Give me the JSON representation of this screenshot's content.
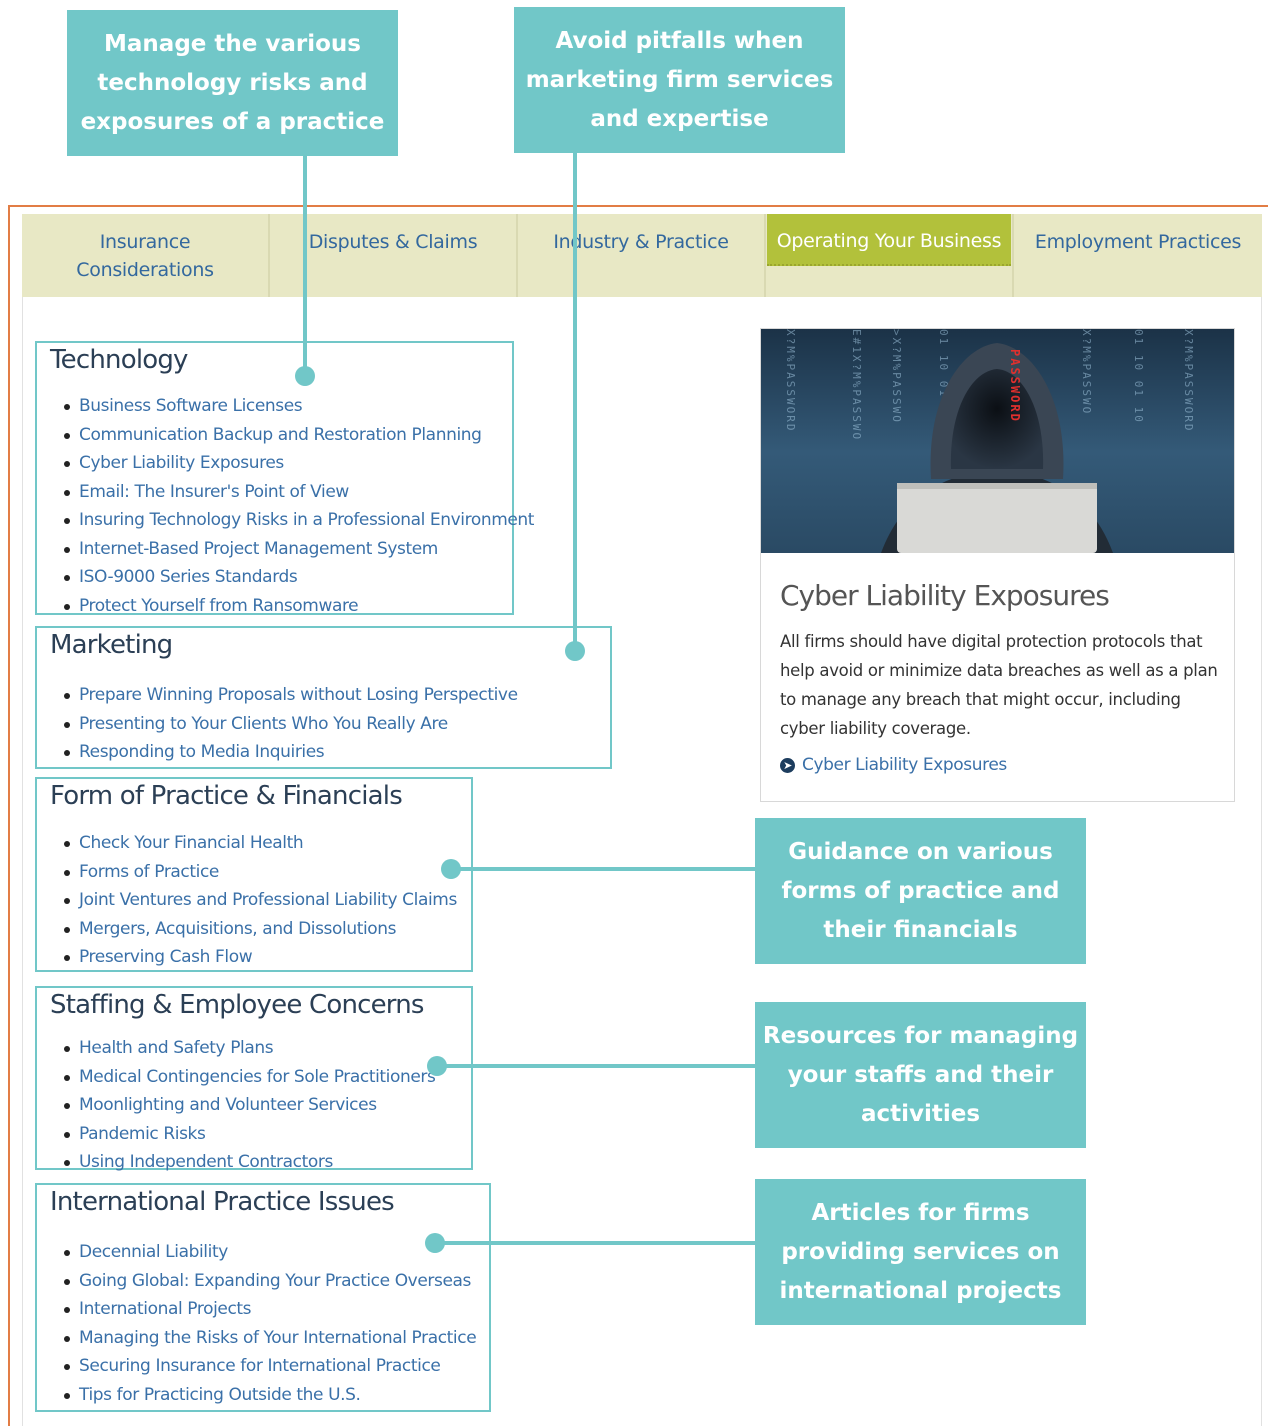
{
  "callouts": {
    "technology": "Manage the various technology risks and exposures of a practice",
    "marketing": "Avoid pitfalls when marketing firm services and expertise",
    "form_of_practice": "Guidance on various forms of practice and their financials",
    "staffing": "Resources for managing your staffs and their activities",
    "international": "Articles for firms providing services on international projects"
  },
  "tabs": [
    {
      "label": "Insurance Considerations"
    },
    {
      "label": "Disputes & Claims"
    },
    {
      "label": "Industry & Practice"
    },
    {
      "label": "Operating Your Business",
      "active": true
    },
    {
      "label": "Employment Practices"
    }
  ],
  "sections": {
    "technology": {
      "title": "Technology",
      "items": [
        "Business Software Licenses",
        "Communication Backup and Restoration Planning",
        "Cyber Liability Exposures",
        "Email: The Insurer's Point of View",
        "Insuring Technology Risks in a Professional Environment",
        "Internet-Based Project Management System",
        "ISO-9000 Series Standards",
        "Protect Yourself from Ransomware"
      ]
    },
    "marketing": {
      "title": "Marketing",
      "items": [
        "Prepare Winning Proposals without Losing Perspective",
        "Presenting to Your Clients Who You Really Are",
        "Responding to Media Inquiries"
      ]
    },
    "form_of_practice": {
      "title": "Form of Practice & Financials",
      "items": [
        "Check Your Financial Health",
        "Forms of Practice",
        "Joint Ventures and Professional Liability Claims",
        "Mergers, Acquisitions, and Dissolutions",
        "Preserving Cash Flow"
      ]
    },
    "staffing": {
      "title": "Staffing & Employee Concerns",
      "items": [
        "Health and Safety Plans",
        "Medical Contingencies for Sole Practitioners",
        "Moonlighting and Volunteer Services",
        "Pandemic Risks",
        "Using Independent Contractors"
      ]
    },
    "international": {
      "title": "International Practice Issues",
      "items": [
        "Decennial Liability",
        "Going Global: Expanding Your Practice Overseas",
        "International Projects",
        "Managing the Risks of Your International Practice",
        "Securing Insurance for International Practice",
        "Tips for Practicing Outside the U.S."
      ]
    }
  },
  "feature_card": {
    "image_icon": "hooded-hacker-laptop-image",
    "title": "Cyber Liability Exposures",
    "body": "All firms should have digital protection protocols that help avoid or minimize data breaches as well as a plan to manage any breach that might occur, including cyber liability coverage.",
    "link_label": "Cyber Liability Exposures",
    "link_icon": "circle-arrow-right-icon"
  },
  "colors": {
    "callout": "#71c7c8",
    "tab_bar": "#e8e8c5",
    "active_tab": "#b2c13b",
    "link": "#3a70a8",
    "frame": "#e27d45"
  }
}
